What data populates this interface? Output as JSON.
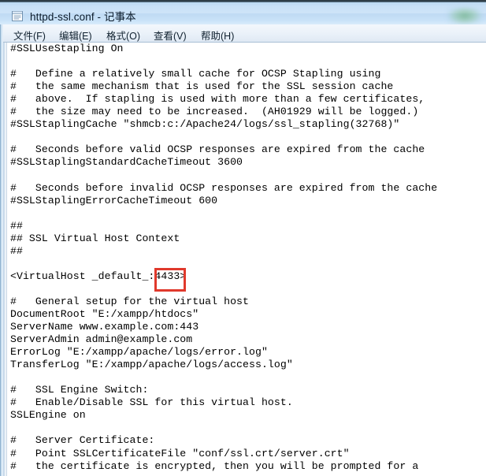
{
  "window": {
    "title": "httpd-ssl.conf - 记事本",
    "icon": "notepad-icon",
    "frame_color": "#c9e1f7"
  },
  "menubar": {
    "items": [
      {
        "label": "文件(F)",
        "name": "menu-file"
      },
      {
        "label": "编辑(E)",
        "name": "menu-edit"
      },
      {
        "label": "格式(O)",
        "name": "menu-format"
      },
      {
        "label": "查看(V)",
        "name": "menu-view"
      },
      {
        "label": "帮助(H)",
        "name": "menu-help"
      }
    ]
  },
  "editor": {
    "content": "#SSLUseStapling On\n\n#   Define a relatively small cache for OCSP Stapling using\n#   the same mechanism that is used for the SSL session cache\n#   above.  If stapling is used with more than a few certificates,\n#   the size may need to be increased.  (AH01929 will be logged.)\n#SSLStaplingCache \"shmcb:c:/Apache24/logs/ssl_stapling(32768)\"\n\n#   Seconds before valid OCSP responses are expired from the cache\n#SSLStaplingStandardCacheTimeout 3600\n\n#   Seconds before invalid OCSP responses are expired from the cache\n#SSLStaplingErrorCacheTimeout 600\n\n##\n## SSL Virtual Host Context\n##\n\n<VirtualHost _default_:4433>\n\n#   General setup for the virtual host\nDocumentRoot \"E:/xampp/htdocs\"\nServerName www.example.com:443\nServerAdmin admin@example.com\nErrorLog \"E:/xampp/apache/logs/error.log\"\nTransferLog \"E:/xampp/apache/logs/access.log\"\n\n#   SSL Engine Switch:\n#   Enable/Disable SSL for this virtual host.\nSSLEngine on\n\n#   Server Certificate:\n#   Point SSLCertificateFile \"conf/ssl.crt/server.crt\"\n#   the certificate is encrypted, then you will be prompted for a"
  },
  "annotation": {
    "highlighted_value": "4433",
    "color": "#e0392c",
    "target_line": "<VirtualHost _default_:4433>"
  }
}
